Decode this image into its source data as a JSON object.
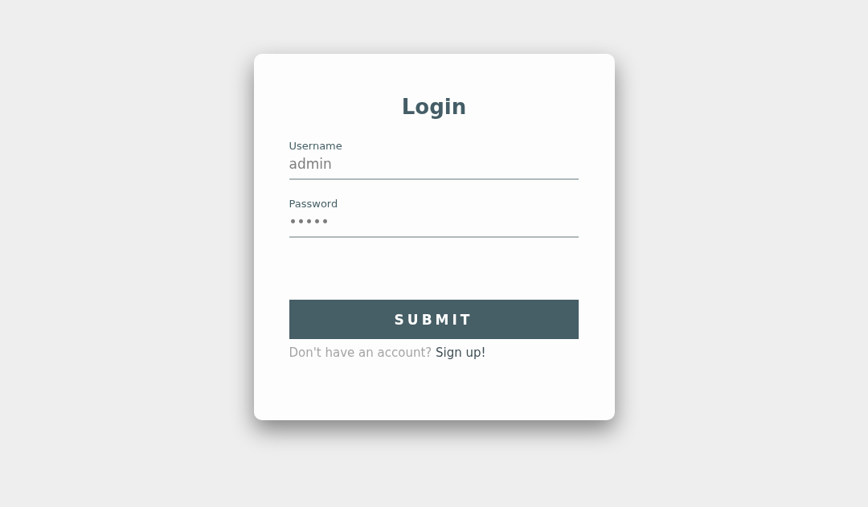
{
  "title": "Login",
  "fields": [
    {
      "label": "Username",
      "value": "admin"
    },
    {
      "label": "Password",
      "value": "•••••"
    }
  ],
  "submit": "SUBMIT",
  "signup": {
    "prompt": "Don't have an account?",
    "link": "Sign up!"
  }
}
